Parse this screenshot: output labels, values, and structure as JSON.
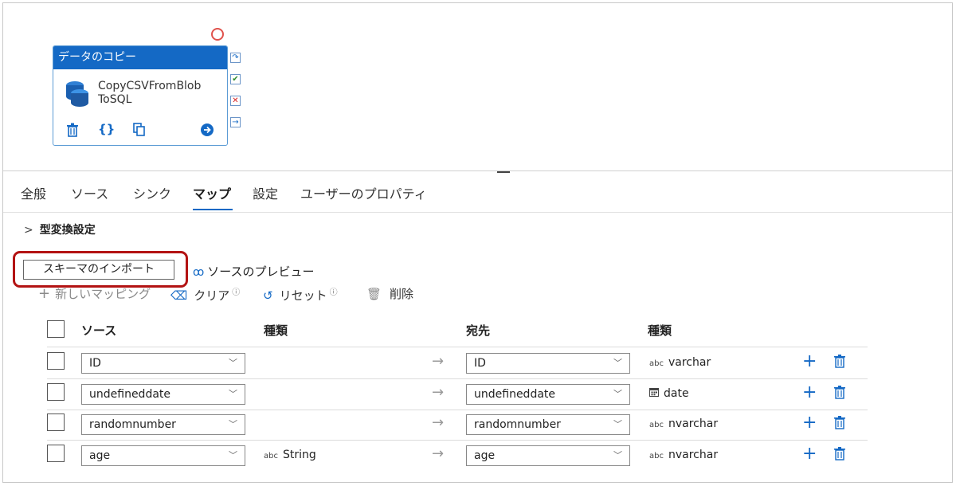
{
  "activity": {
    "header": "データのコピー",
    "name_line1": "CopyCSVFromBlob",
    "name_line2": "ToSQL"
  },
  "tabs": [
    {
      "label": "全般"
    },
    {
      "label": "ソース"
    },
    {
      "label": "シンク"
    },
    {
      "label": "マップ",
      "active": true
    },
    {
      "label": "設定"
    },
    {
      "label": "ユーザーのプロパティ"
    }
  ],
  "type_conversion": {
    "label": "型変換設定"
  },
  "toolbar": {
    "import_schema": "スキーマのインポート",
    "preview_source": "ソースのプレビュー",
    "new_mapping": "新しいマッピング",
    "clear": "クリア",
    "reset": "リセット",
    "delete": "削除"
  },
  "table": {
    "headers": {
      "source": "ソース",
      "source_type": "種類",
      "destination": "宛先",
      "destination_type": "種類"
    },
    "rows": [
      {
        "source": "ID",
        "source_type": "",
        "destination": "ID",
        "dest_type_icon": "abc",
        "dest_type": "varchar"
      },
      {
        "source": "undefineddate",
        "source_type": "",
        "destination": "undefineddate",
        "dest_type_icon": "calendar-icon",
        "dest_type": "date"
      },
      {
        "source": "randomnumber",
        "source_type": "",
        "destination": "randomnumber",
        "dest_type_icon": "abc",
        "dest_type": "nvarchar"
      },
      {
        "source": "age",
        "source_type_icon": "abc",
        "source_type": "String",
        "destination": "age",
        "dest_type_icon": "abc",
        "dest_type": "nvarchar"
      }
    ]
  },
  "colors": {
    "accent": "#1469c5",
    "highlight": "#b31313",
    "fail": "#e0524c",
    "success": "#2e8b2e"
  }
}
